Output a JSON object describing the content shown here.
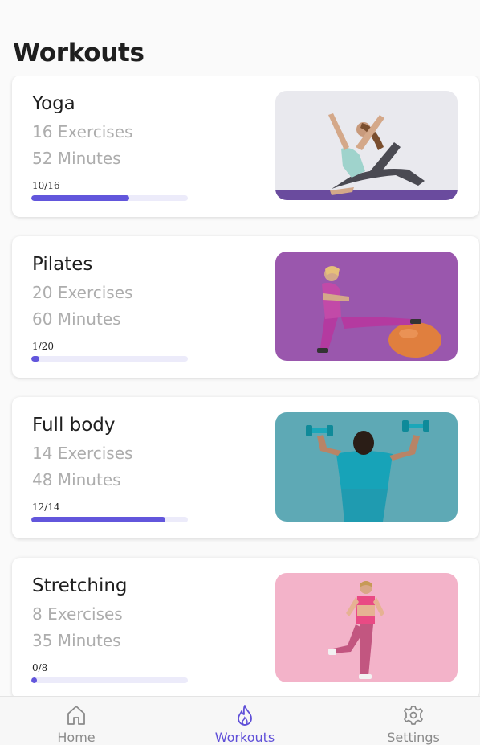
{
  "page_title": "Workouts",
  "workouts": [
    {
      "title": "Yoga",
      "exercises": "16 Exercises",
      "minutes": "52 Minutes",
      "progress_text": "10/16",
      "progress": 0.625,
      "image_icon": "yoga-photo"
    },
    {
      "title": "Pilates",
      "exercises": "20 Exercises",
      "minutes": "60 Minutes",
      "progress_text": "1/20",
      "progress": 0.05,
      "image_icon": "pilates-photo"
    },
    {
      "title": "Full body",
      "exercises": "14 Exercises",
      "minutes": "48 Minutes",
      "progress_text": "12/14",
      "progress": 0.857,
      "image_icon": "full-body-photo"
    },
    {
      "title": "Stretching",
      "exercises": "8 Exercises",
      "minutes": "35 Minutes",
      "progress_text": "0/8",
      "progress": 0.0,
      "image_icon": "stretching-photo"
    }
  ],
  "tabbar": {
    "items": [
      {
        "label": "Home",
        "icon": "home-icon",
        "active": false
      },
      {
        "label": "Workouts",
        "icon": "flame-icon",
        "active": true
      },
      {
        "label": "Settings",
        "icon": "gear-icon",
        "active": false
      }
    ]
  },
  "colors": {
    "accent": "#6256dc",
    "progress_track": "#ecebfa",
    "pilates_bg": "#9a57ad",
    "fullbody_bg": "#5ea9b5",
    "stretching_bg": "#f3b3c9",
    "yoga_bg": "#e9e9ee"
  }
}
